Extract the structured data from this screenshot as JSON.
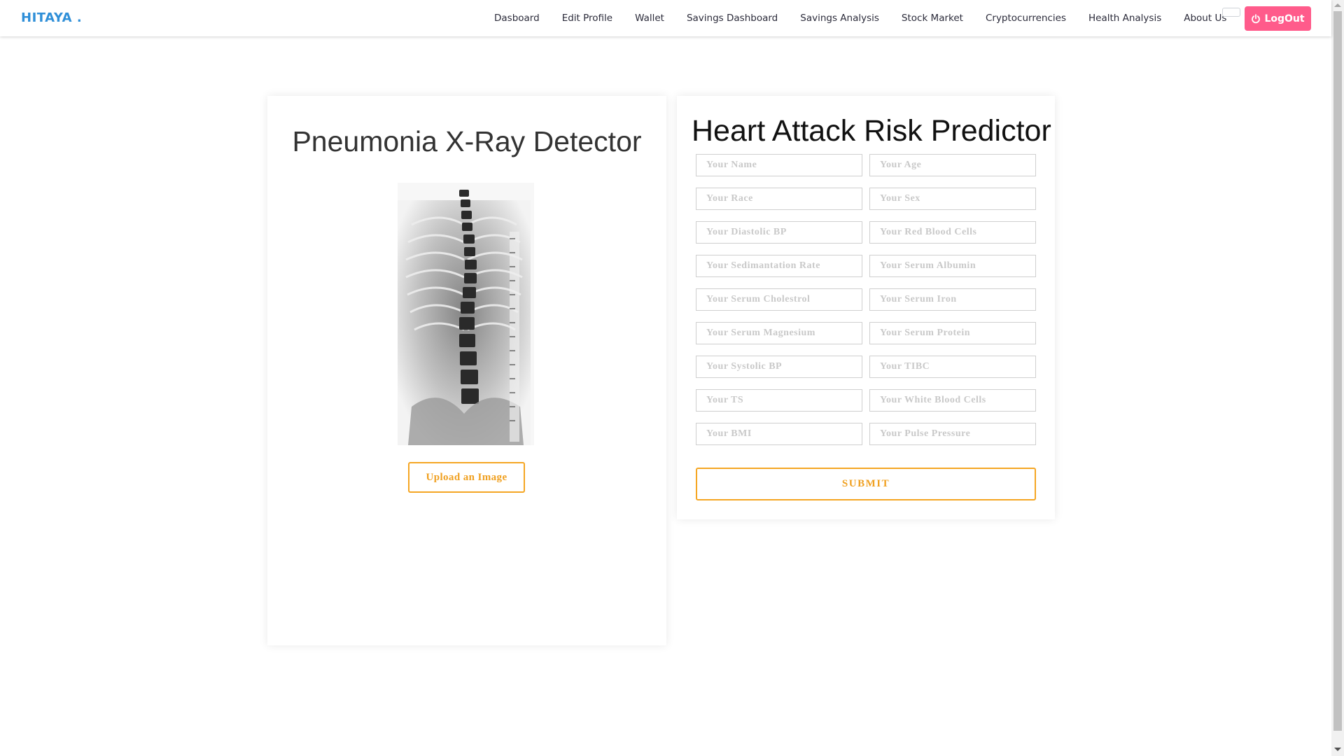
{
  "brand": "HITAYA .",
  "nav": [
    {
      "label": "Dasboard",
      "name": "nav-dashboard"
    },
    {
      "label": "Edit Profile",
      "name": "nav-edit-profile"
    },
    {
      "label": "Wallet",
      "name": "nav-wallet"
    },
    {
      "label": "Savings Dashboard",
      "name": "nav-savings-dashboard"
    },
    {
      "label": "Savings Analysis",
      "name": "nav-savings-analysis"
    },
    {
      "label": "Stock Market",
      "name": "nav-stock-market"
    },
    {
      "label": "Cryptocurrencies",
      "name": "nav-cryptocurrencies"
    },
    {
      "label": "Health Analysis",
      "name": "nav-health-analysis"
    },
    {
      "label": "About Us",
      "name": "nav-about-us"
    }
  ],
  "logout": {
    "label": "LogOut",
    "icon": "power-icon",
    "color": "#ff5b8b"
  },
  "pneumonia": {
    "title": "Pneumonia X-Ray Detector",
    "upload_label": "Upload an Image",
    "accent": "#f5a623"
  },
  "heart": {
    "title": "Heart Attack Risk Predictor",
    "fields": [
      "Your Name",
      "Your Age",
      "Your Race",
      "Your Sex",
      "Your Diastolic BP",
      "Your Red Blood Cells",
      "Your Sedimantation Rate",
      "Your Serum Albumin",
      "Your Serum Cholestrol",
      "Your Serum Iron",
      "Your Serum Magnesium",
      "Your Serum Protein",
      "Your Systolic BP",
      "Your TIBC",
      "Your TS",
      "Your White Blood Cells",
      "Your BMI",
      "Your Pulse Pressure"
    ],
    "submit_label": "SUBMIT"
  }
}
